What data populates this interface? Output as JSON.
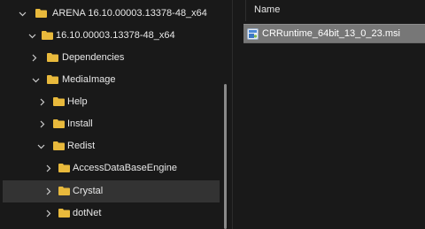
{
  "tree": {
    "items": [
      {
        "label": "ARENA 16.10.00003.13378-48_x64",
        "expanded": true
      },
      {
        "label": "16.10.00003.13378-48_x64",
        "expanded": true
      },
      {
        "label": "Dependencies",
        "expanded": false
      },
      {
        "label": "MediaImage",
        "expanded": true
      },
      {
        "label": "Help",
        "expanded": false
      },
      {
        "label": "Install",
        "expanded": false
      },
      {
        "label": "Redist",
        "expanded": true
      },
      {
        "label": "AccessDataBaseEngine",
        "expanded": false
      },
      {
        "label": "Crystal",
        "expanded": false,
        "selected": true
      },
      {
        "label": "dotNet",
        "expanded": false
      }
    ]
  },
  "list": {
    "column_name": "Name",
    "files": [
      {
        "name": "CRRuntime_64bit_13_0_23.msi",
        "icon": "msi-installer-icon"
      }
    ]
  },
  "colors": {
    "background": "#191919",
    "folder": "#e8b93c",
    "selected_row": "#333333",
    "selected_file": "#777777"
  }
}
